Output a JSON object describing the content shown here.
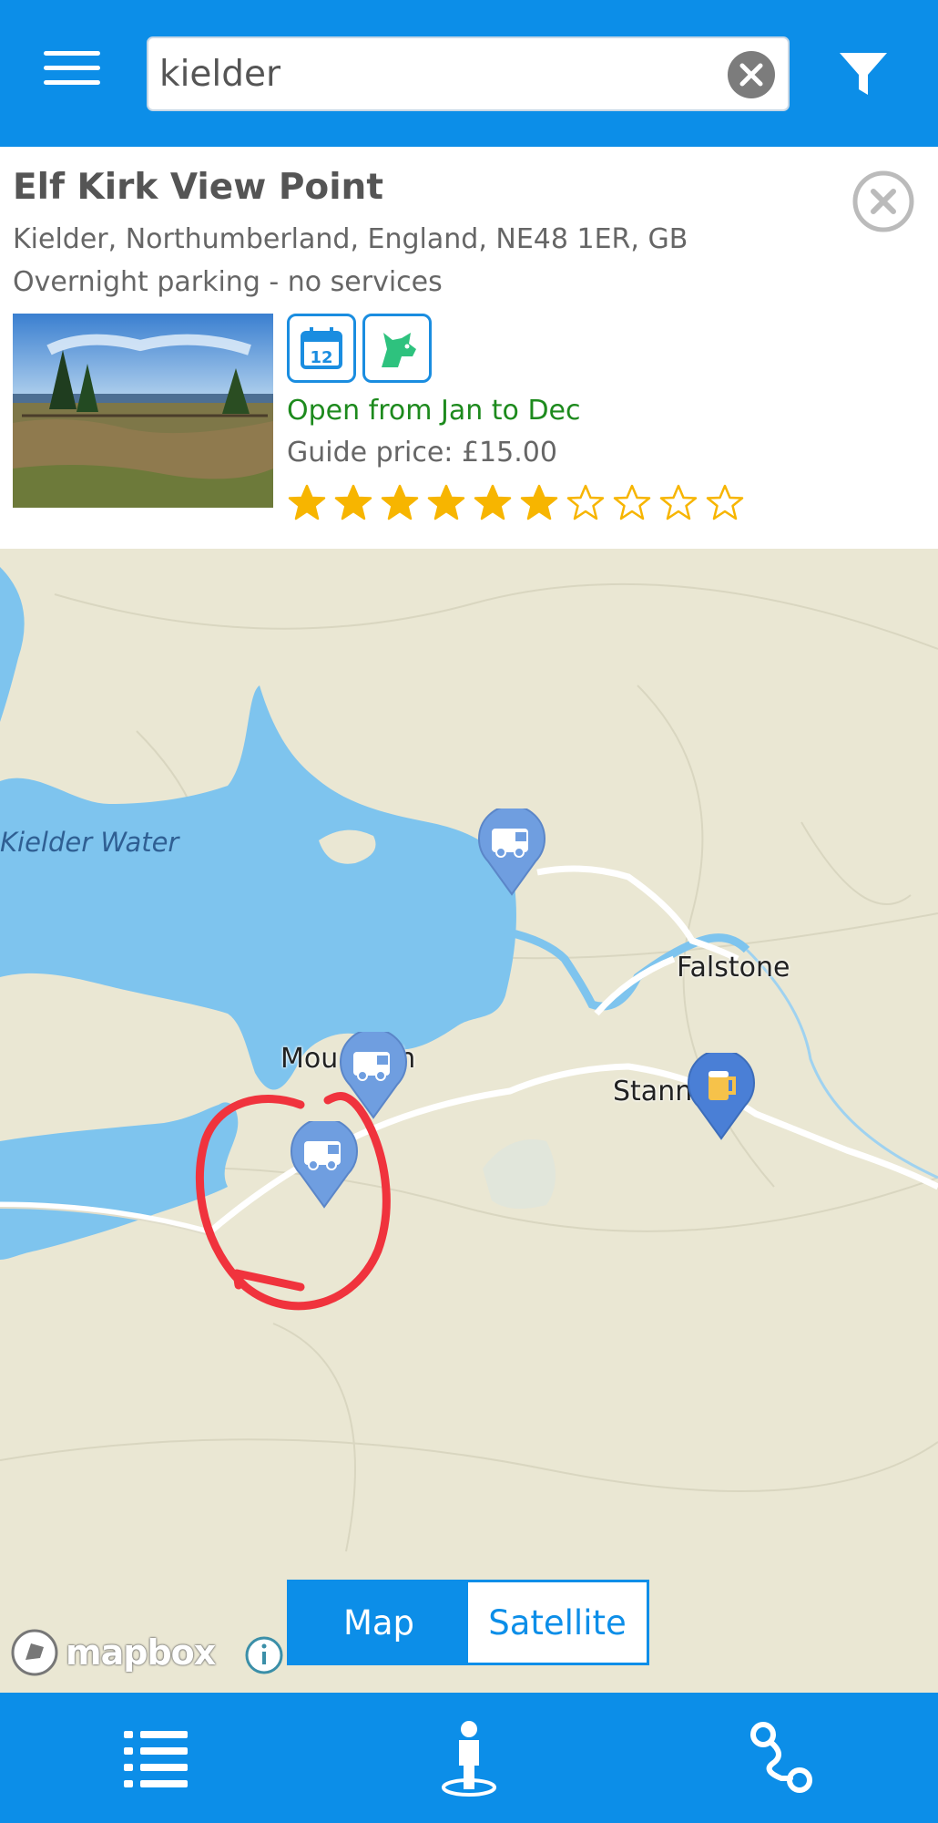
{
  "search": {
    "value": "kielder",
    "placeholder": ""
  },
  "card": {
    "title": "Elf Kirk View Point",
    "address": "Kielder, Northumberland, England, NE48 1ER, GB",
    "type": "Overnight parking - no services",
    "calendar_badge_number": "12",
    "open_text": "Open from Jan to Dec",
    "price_text": "Guide price: £15.00",
    "rating": 6,
    "rating_max": 10
  },
  "map": {
    "water_label": "Kielder Water",
    "place_labels": {
      "falstone": "Falstone",
      "mounthaugh": "Mou  augh",
      "stannersburn": "Stann      urn"
    },
    "toggle": {
      "map": "Map",
      "satellite": "Satellite",
      "selected": "Map"
    },
    "attribution": "mapbox"
  },
  "colors": {
    "primary": "#0c8ee8",
    "water": "#7ec4ee",
    "land": "#eae7d3",
    "star": "#f7b500",
    "open": "#1d8a1d",
    "annotation": "#f0333d",
    "pin": "#6f9ee0"
  },
  "icons": {
    "menu": "hamburger-menu-icon",
    "clear": "clear-x-icon",
    "filter": "funnel-filter-icon",
    "close": "close-circle-icon",
    "calendar": "calendar-icon",
    "dog": "dog-icon",
    "pin_camper": "campervan-pin-icon",
    "pin_pub": "beer-mug-pin-icon",
    "list": "list-icon",
    "person": "person-location-icon",
    "route": "route-icon",
    "info": "info-icon"
  }
}
